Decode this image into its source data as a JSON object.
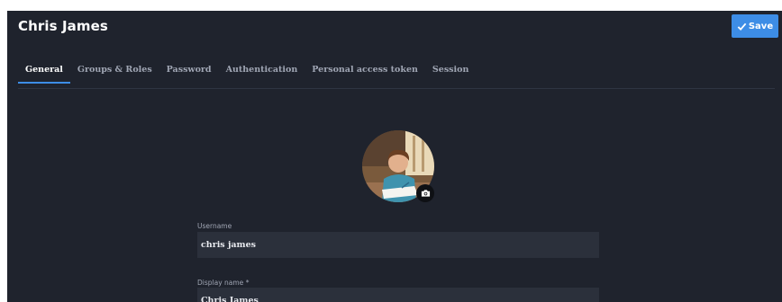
{
  "header": {
    "title": "Chris James",
    "save_label": "Save"
  },
  "tabs": [
    {
      "label": "General",
      "active": true
    },
    {
      "label": "Groups & Roles",
      "active": false
    },
    {
      "label": "Password",
      "active": false
    },
    {
      "label": "Authentication",
      "active": false
    },
    {
      "label": "Personal access token",
      "active": false
    },
    {
      "label": "Session",
      "active": false
    }
  ],
  "form": {
    "username": {
      "label": "Username",
      "value": "chris james"
    },
    "display_name": {
      "label": "Display name",
      "required_mark": "*",
      "value": "Chris James"
    }
  },
  "icons": {
    "save": "check-icon",
    "avatar_action": "camera-icon"
  },
  "colors": {
    "background": "#1f232d",
    "accent": "#3d8de6",
    "input_bg": "#2b303b"
  }
}
